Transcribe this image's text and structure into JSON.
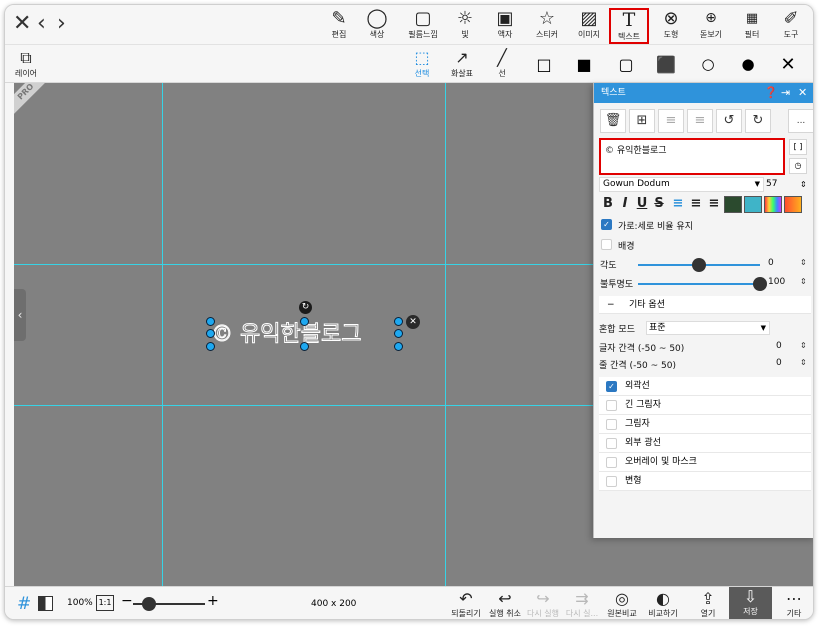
{
  "topbar": {
    "nav_close": "✕",
    "nav_back": "‹",
    "nav_forward": "›",
    "tools": [
      {
        "label": "편집",
        "icon": "edit-icon"
      },
      {
        "label": "색상",
        "icon": "color-ring-icon"
      },
      {
        "label": "필름느낌",
        "icon": "film-icon"
      },
      {
        "label": "빛",
        "icon": "sun-icon"
      },
      {
        "label": "액자",
        "icon": "frame-icon"
      },
      {
        "label": "스티커",
        "icon": "sticker-icon"
      },
      {
        "label": "이미지",
        "icon": "image-icon"
      },
      {
        "label": "텍스트",
        "icon": "text-icon",
        "selected": true
      },
      {
        "label": "도형",
        "icon": "shape-icon"
      },
      {
        "label": "돋보기",
        "icon": "magnifier-icon"
      },
      {
        "label": "필터",
        "icon": "filter-icon"
      },
      {
        "label": "도구",
        "icon": "tools-icon"
      }
    ]
  },
  "subbar": {
    "layer_label": "레이어",
    "select_label": "선택",
    "arrow_label": "화살표",
    "line_label": "선",
    "close": "✕"
  },
  "canvas": {
    "pro_badge": "PRO",
    "text_content": "© 유익한블로그",
    "expand_icon": "‹"
  },
  "panel": {
    "title": "텍스트",
    "text_value": "© 유익한블로그",
    "bracket_btn": "[ ]",
    "more_btn": "...",
    "font_name": "Gowun Dodum",
    "font_size": "57",
    "keep_ratio_label": "가로:세로 비율 유지",
    "background_label": "배경",
    "angle_label": "각도",
    "angle_value": "0",
    "opacity_label": "불투명도",
    "opacity_value": "100",
    "angle_level": 0.5,
    "opacity_level": 1.0,
    "more_options_label": "기타 옵션",
    "blend_label": "혼합 모드",
    "blend_value": "표준",
    "letter_spacing_label": "글자 간격 (-50 ~ 50)",
    "letter_spacing_value": "0",
    "line_spacing_label": "줄 간격 (-50 ~ 50)",
    "line_spacing_value": "0",
    "options": [
      {
        "label": "외곽선",
        "checked": true
      },
      {
        "label": "긴 그림자",
        "checked": false
      },
      {
        "label": "그림자",
        "checked": false
      },
      {
        "label": "외부 광선",
        "checked": false
      },
      {
        "label": "오버레이 및 마스크",
        "checked": false
      },
      {
        "label": "변형",
        "checked": false
      }
    ],
    "colors": {
      "title_bg": "#2f93db",
      "text_color_swatch": "#2b4a2e",
      "stroke_swatch": "#3fb4c8"
    }
  },
  "bottombar": {
    "zoom": "100%",
    "ratio_btn": "1:1",
    "canvas_size": "400 x 200",
    "actions": [
      {
        "label": "되돌리기",
        "icon": "revert-icon",
        "disabled": false
      },
      {
        "label": "실행 취소",
        "icon": "undo-icon",
        "disabled": false
      },
      {
        "label": "다시 실행",
        "icon": "redo-icon",
        "disabled": true
      },
      {
        "label": "다시 실...",
        "icon": "redo-all-icon",
        "disabled": true
      },
      {
        "label": "원본비교",
        "icon": "compare-original-icon",
        "disabled": false
      },
      {
        "label": "비교하기",
        "icon": "compare-icon",
        "disabled": false
      },
      {
        "label": "열기",
        "icon": "open-icon",
        "disabled": false
      },
      {
        "label": "저장",
        "icon": "save-icon",
        "disabled": false
      },
      {
        "label": "기타",
        "icon": "more-icon",
        "disabled": false
      }
    ]
  }
}
